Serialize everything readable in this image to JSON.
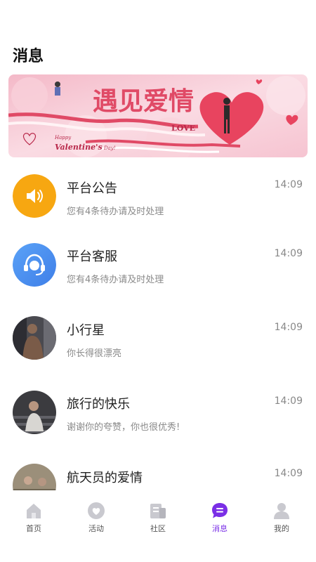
{
  "header": {
    "title": "消息"
  },
  "banner": {
    "headline": "遇见爱情",
    "love_text": "LOVE",
    "happy_text": "Happy",
    "valentine_text": "Valentine's",
    "day_text": "Day!",
    "colors": {
      "background": "#f7c9d4",
      "accent": "#e8445f",
      "pink_light": "#fde3ea"
    }
  },
  "messages": [
    {
      "name": "平台公告",
      "time": "14:09",
      "preview": "您有4条待办请及时处理",
      "avatar": "speaker-icon",
      "avatar_color": "#f7a711"
    },
    {
      "name": "平台客服",
      "time": "14:09",
      "preview": "您有4条待办请及时处理",
      "avatar": "headset-icon",
      "avatar_color": "#4f8ff0"
    },
    {
      "name": "小行星",
      "time": "14:09",
      "preview": "你长得很漂亮",
      "avatar": "user-photo"
    },
    {
      "name": "旅行的快乐",
      "time": "14:09",
      "preview": "谢谢你的夸赞，你也很优秀!",
      "avatar": "user-photo"
    },
    {
      "name": "航天员的爱情",
      "time": "14:09",
      "preview": "",
      "avatar": "user-photo"
    }
  ],
  "tabbar": {
    "active_color": "#7a2fe6",
    "inactive_color": "#c9c9cf",
    "items": [
      {
        "label": "首页",
        "icon": "home-icon"
      },
      {
        "label": "活动",
        "icon": "heart-icon"
      },
      {
        "label": "社区",
        "icon": "community-icon"
      },
      {
        "label": "消息",
        "icon": "message-icon",
        "active": true
      },
      {
        "label": "我的",
        "icon": "profile-icon"
      }
    ]
  }
}
